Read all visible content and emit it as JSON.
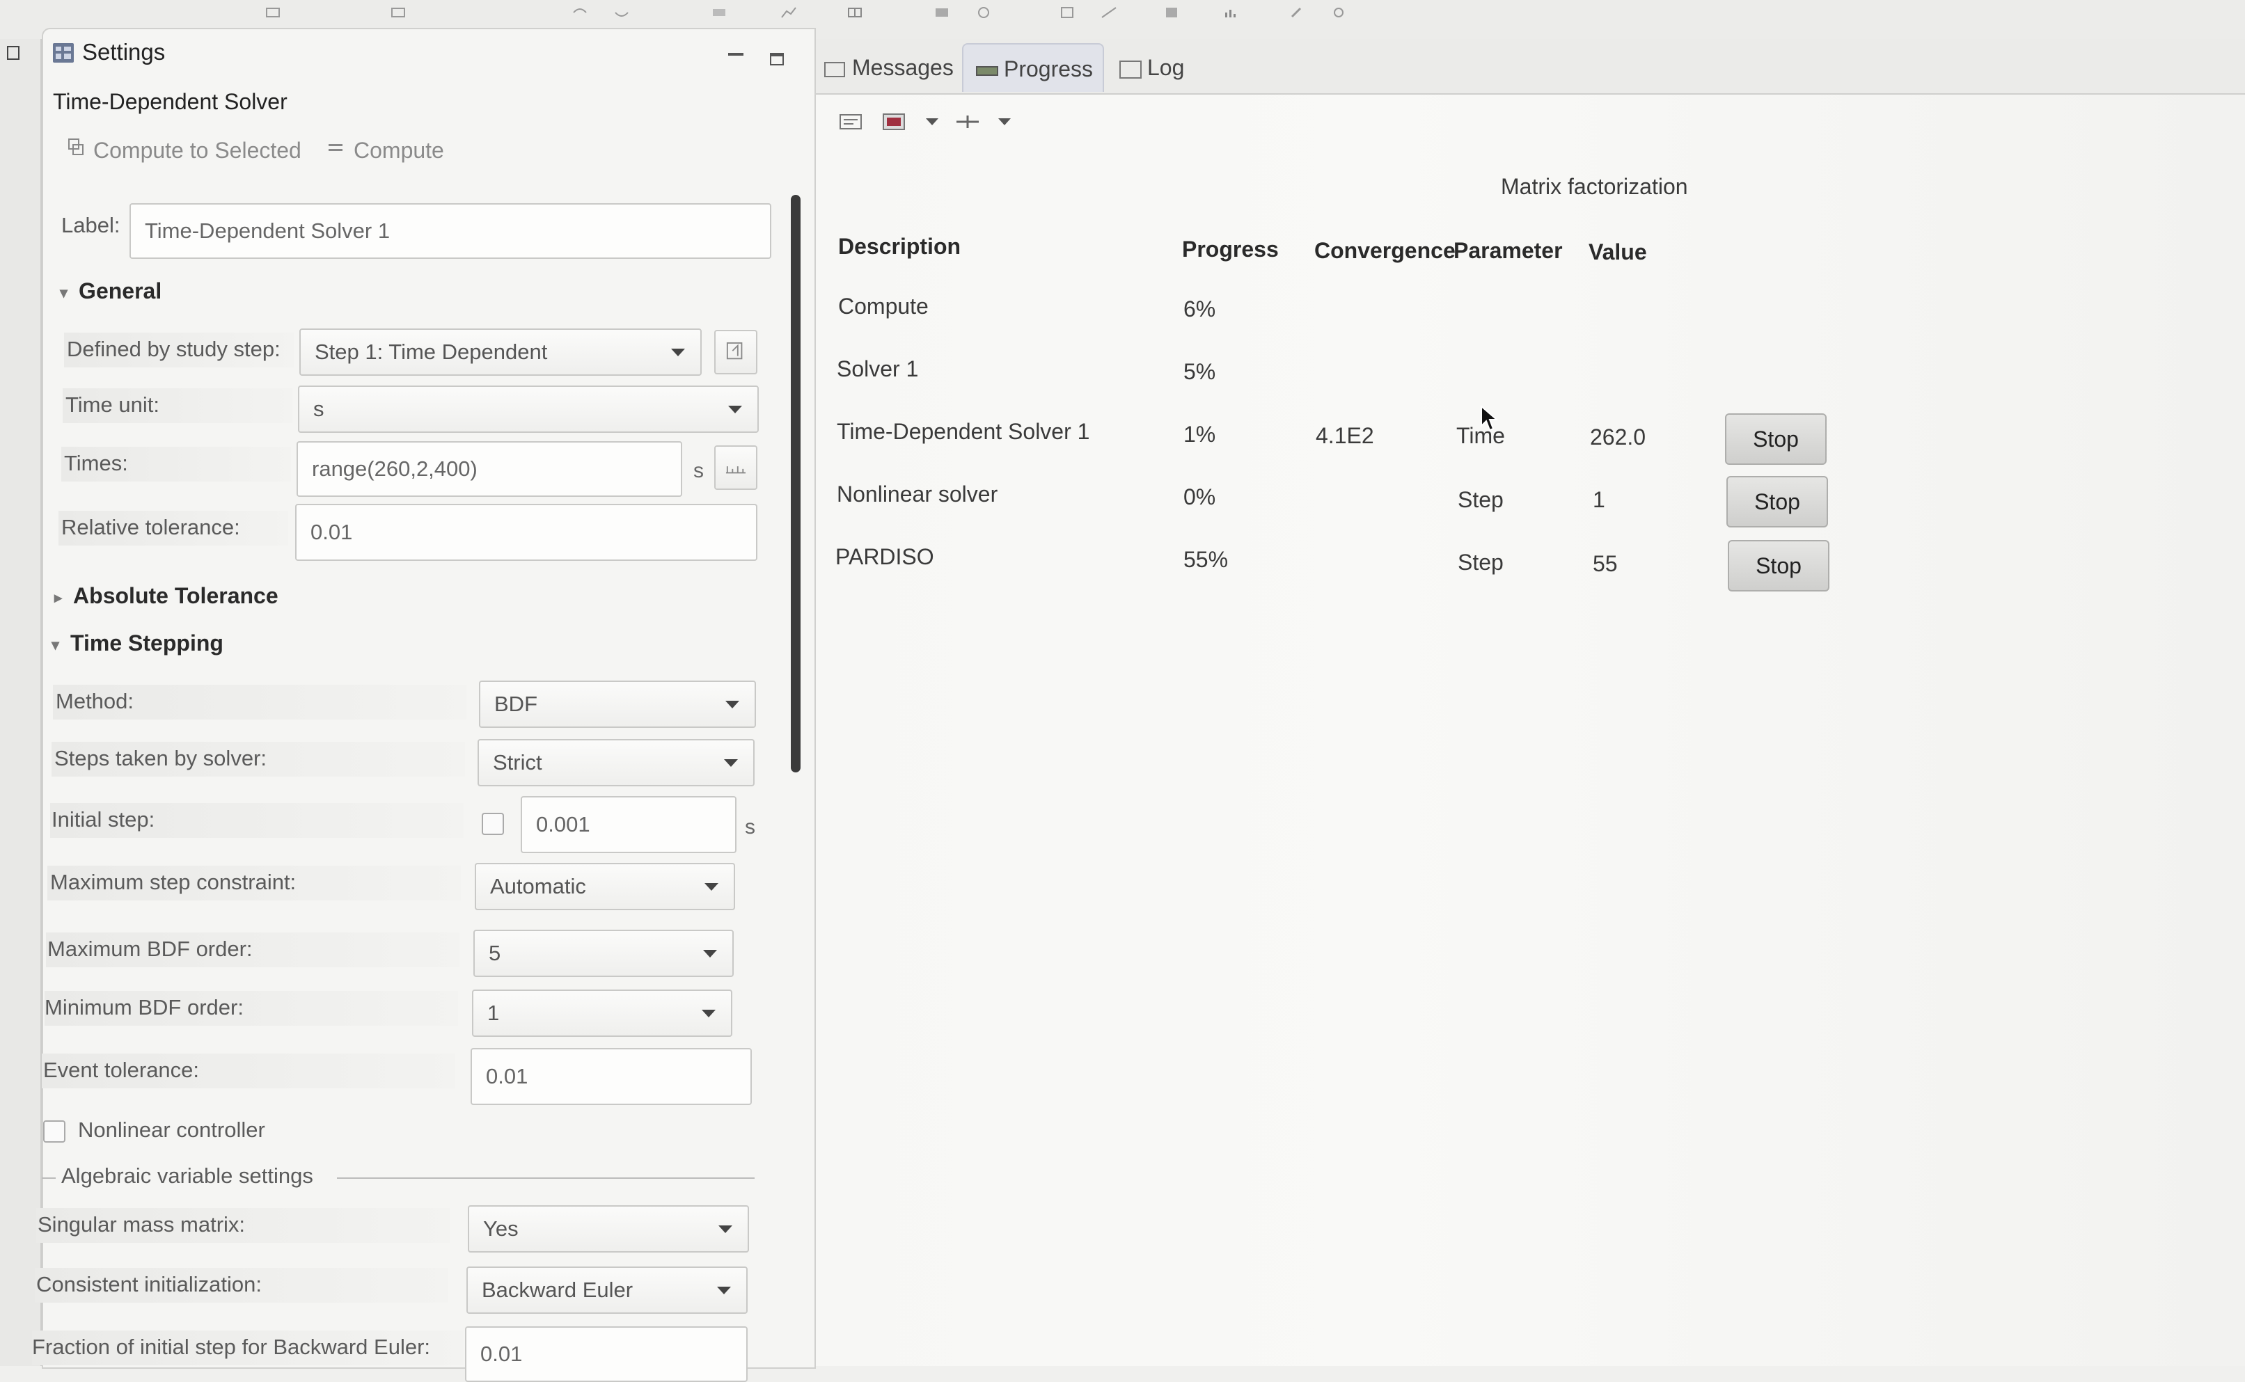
{
  "settings": {
    "title": "Settings",
    "subtitle": "Time-Dependent Solver",
    "compute_to_selected": "Compute to Selected",
    "compute": "Compute",
    "label_label": "Label:",
    "label_value": "Time-Dependent Solver 1",
    "general": {
      "heading": "General",
      "study_step_label": "Defined by study step:",
      "study_step_value": "Step 1: Time Dependent",
      "time_unit_label": "Time unit:",
      "time_unit_value": "s",
      "times_label": "Times:",
      "times_value": "range(260,2,400)",
      "times_unit": "s",
      "rel_tol_label": "Relative tolerance:",
      "rel_tol_value": "0.01"
    },
    "absolute_tolerance": "Absolute Tolerance",
    "time_stepping": {
      "heading": "Time Stepping",
      "method_label": "Method:",
      "method_value": "BDF",
      "steps_label": "Steps taken by solver:",
      "steps_value": "Strict",
      "initial_step_label": "Initial step:",
      "initial_step_value": "0.001",
      "initial_step_unit": "s",
      "max_step_label": "Maximum step constraint:",
      "max_step_value": "Automatic",
      "max_bdf_label": "Maximum BDF order:",
      "max_bdf_value": "5",
      "min_bdf_label": "Minimum BDF order:",
      "min_bdf_value": "1",
      "event_tol_label": "Event tolerance:",
      "event_tol_value": "0.01",
      "nonlinear_controller": "Nonlinear controller",
      "algebraic_heading": "Algebraic variable settings",
      "singular_label": "Singular mass matrix:",
      "singular_value": "Yes",
      "consistent_label": "Consistent initialization:",
      "consistent_value": "Backward Euler",
      "fraction_label": "Fraction of initial step for Backward Euler:",
      "fraction_value": "0.01"
    }
  },
  "tabs": {
    "messages": "Messages",
    "progress": "Progress",
    "log": "Log"
  },
  "progress": {
    "status": "Matrix factorization",
    "headers": {
      "description": "Description",
      "progress": "Progress",
      "convergence": "Convergence",
      "parameter": "Parameter",
      "value": "Value"
    },
    "rows": [
      {
        "description": "Compute",
        "progress": "6%",
        "convergence": "",
        "parameter": "",
        "value": "",
        "stop": ""
      },
      {
        "description": "Solver 1",
        "progress": "5%",
        "convergence": "",
        "parameter": "",
        "value": "",
        "stop": ""
      },
      {
        "description": "Time-Dependent Solver 1",
        "progress": "1%",
        "convergence": "4.1E2",
        "parameter": "Time",
        "value": "262.0",
        "stop": "Stop"
      },
      {
        "description": "Nonlinear solver",
        "progress": "0%",
        "convergence": "",
        "parameter": "Step",
        "value": "1",
        "stop": "Stop"
      },
      {
        "description": "PARDISO",
        "progress": "55%",
        "convergence": "",
        "parameter": "Step",
        "value": "55",
        "stop": "Stop"
      }
    ]
  },
  "colors": {
    "panel_bg": "#f5f5f3",
    "tab_active_bg": "#e1e3ea",
    "button_bg": "#d9d9d7"
  }
}
